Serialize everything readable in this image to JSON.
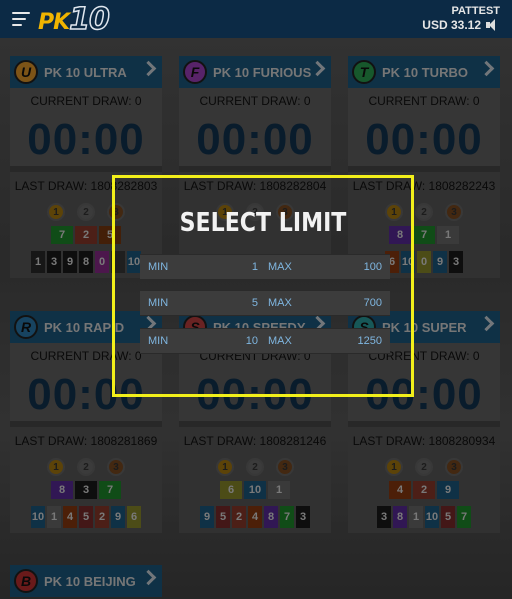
{
  "header": {
    "logo_pk": "PK",
    "logo_ten": "10",
    "username": "PATTEST",
    "balance": "USD 33.12"
  },
  "cards": [
    {
      "title": "PK 10 ULTRA",
      "badge": "U",
      "badge_color": "#e39a2a",
      "current": "CURRENT DRAW: 0",
      "timer": "00:00",
      "last": "LAST DRAW: 1808282803",
      "top3": [
        {
          "n": "7",
          "c": "#1e8a2a"
        },
        {
          "n": "2",
          "c": "#8a3a2a"
        },
        {
          "n": "5",
          "c": "#7a3a10"
        }
      ],
      "nums": [
        {
          "n": "1",
          "c": "#2a2a2a"
        },
        {
          "n": "3",
          "c": "#1a1a1a"
        },
        {
          "n": "9",
          "c": "#1a1a1a"
        },
        {
          "n": "8",
          "c": "#1a1a1a"
        },
        {
          "n": "0",
          "c": "#8a2a8a"
        },
        {
          "n": "",
          "c": "#3a3a3a"
        },
        {
          "n": "10",
          "c": "#1c5a80"
        }
      ]
    },
    {
      "title": "PK 10 FURIOUS",
      "badge": "F",
      "badge_color": "#a040c0",
      "current": "CURRENT DRAW: 0",
      "timer": "00:00",
      "last": "LAST DRAW: 1808282804",
      "top3": [],
      "nums": []
    },
    {
      "title": "PK 10 TURBO",
      "badge": "T",
      "badge_color": "#2aa050",
      "current": "CURRENT DRAW: 0",
      "timer": "00:00",
      "last": "LAST DRAW: 1808282243",
      "top3": [
        {
          "n": "8",
          "c": "#5a2a9a"
        },
        {
          "n": "7",
          "c": "#1e8a2a"
        },
        {
          "n": "1",
          "c": "#6a6a6a"
        }
      ],
      "nums": [
        {
          "n": "6",
          "c": "#8a3a10"
        },
        {
          "n": "10",
          "c": "#1c5a80"
        },
        {
          "n": "0",
          "c": "#8a8a2a"
        },
        {
          "n": "9",
          "c": "#1c5a80"
        },
        {
          "n": "3",
          "c": "#1a1a1a"
        }
      ]
    },
    {
      "title": "PK 10 RAPID",
      "badge": "R",
      "badge_color": "#2a7ab0",
      "current": "CURRENT DRAW: 0",
      "timer": "00:00",
      "last": "LAST DRAW: 1808281869",
      "top3": [
        {
          "n": "8",
          "c": "#5a2a9a"
        },
        {
          "n": "3",
          "c": "#1a1a1a"
        },
        {
          "n": "7",
          "c": "#1e8a2a"
        }
      ],
      "nums": [
        {
          "n": "10",
          "c": "#1c5a80"
        },
        {
          "n": "1",
          "c": "#6a6a6a"
        },
        {
          "n": "4",
          "c": "#8a3a10"
        },
        {
          "n": "5",
          "c": "#7a2a2a"
        },
        {
          "n": "2",
          "c": "#8a3a2a"
        },
        {
          "n": "9",
          "c": "#1c5a80"
        },
        {
          "n": "6",
          "c": "#8a8a2a"
        }
      ]
    },
    {
      "title": "PK 10 SPEEDY",
      "badge": "S",
      "badge_color": "#c04040",
      "current": "CURRENT DRAW: 0",
      "timer": "00:00",
      "last": "LAST DRAW: 1808281246",
      "top3": [
        {
          "n": "6",
          "c": "#8a8a2a"
        },
        {
          "n": "10",
          "c": "#1c5a80"
        },
        {
          "n": "1",
          "c": "#6a6a6a"
        }
      ],
      "nums": [
        {
          "n": "9",
          "c": "#1c5a80"
        },
        {
          "n": "5",
          "c": "#7a2a2a"
        },
        {
          "n": "2",
          "c": "#8a3a2a"
        },
        {
          "n": "4",
          "c": "#8a3a10"
        },
        {
          "n": "8",
          "c": "#5a2a9a"
        },
        {
          "n": "7",
          "c": "#1e8a2a"
        },
        {
          "n": "3",
          "c": "#1a1a1a"
        }
      ]
    },
    {
      "title": "PK 10 SUPER",
      "badge": "S",
      "badge_color": "#2aa0a0",
      "current": "CURRENT DRAW: 0",
      "timer": "00:00",
      "last": "LAST DRAW: 1808280934",
      "top3": [
        {
          "n": "4",
          "c": "#8a3a10"
        },
        {
          "n": "2",
          "c": "#8a3a2a"
        },
        {
          "n": "9",
          "c": "#1c5a80"
        }
      ],
      "nums": [
        {
          "n": "3",
          "c": "#1a1a1a"
        },
        {
          "n": "8",
          "c": "#5a2a9a"
        },
        {
          "n": "1",
          "c": "#6a6a6a"
        },
        {
          "n": "10",
          "c": "#1c5a80"
        },
        {
          "n": "5",
          "c": "#7a2a2a"
        },
        {
          "n": "7",
          "c": "#1e8a2a"
        }
      ]
    }
  ],
  "beijing": {
    "title": "PK 10 BEIJING",
    "badge": "B",
    "badge_color": "#c03030"
  },
  "medal_labels": [
    "1",
    "2",
    "3"
  ],
  "limit_modal": {
    "title": "SELECT LIMIT",
    "rows": [
      {
        "min_label": "MIN",
        "min": "1",
        "max_label": "MAX",
        "max": "100"
      },
      {
        "min_label": "MIN",
        "min": "5",
        "max_label": "MAX",
        "max": "700"
      },
      {
        "min_label": "MIN",
        "min": "10",
        "max_label": "MAX",
        "max": "1250"
      }
    ]
  }
}
